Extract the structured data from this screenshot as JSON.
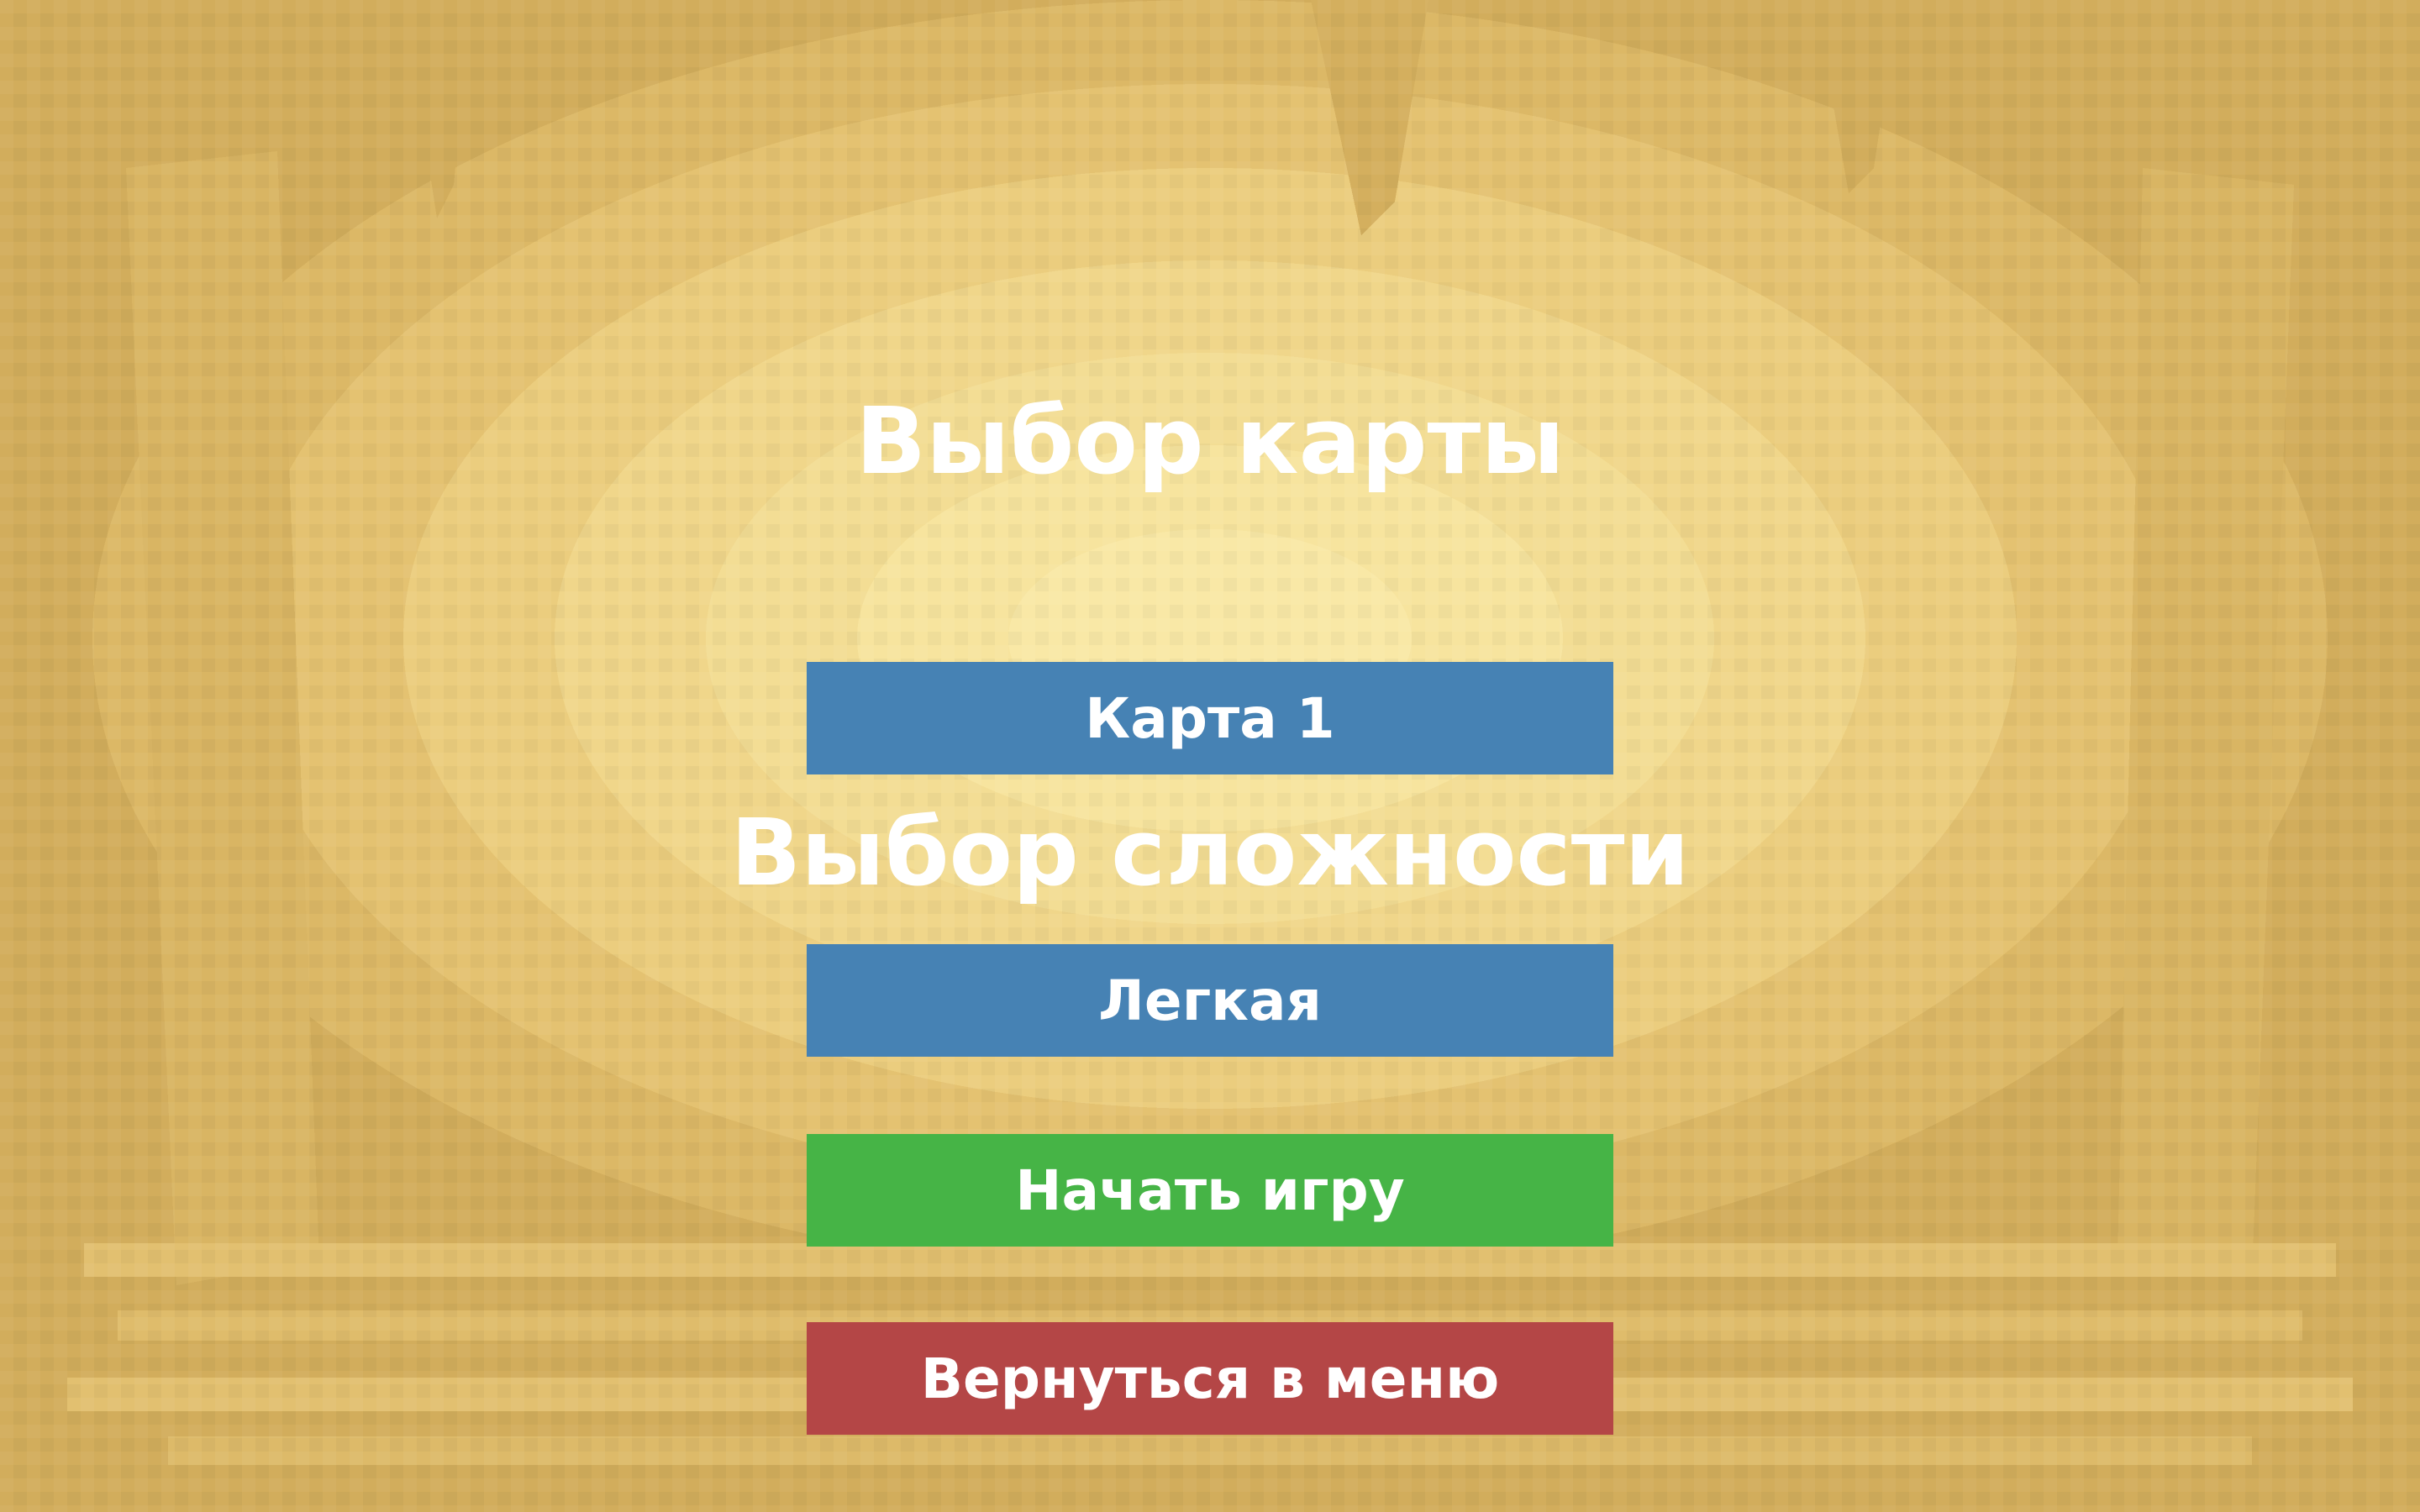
{
  "screen": {
    "map_title": "Выбор карты",
    "difficulty_title": "Выбор сложности"
  },
  "buttons": {
    "map": {
      "label": "Карта 1",
      "color": "#4682b4"
    },
    "difficulty": {
      "label": "Легкая",
      "color": "#4682b4"
    },
    "start": {
      "label": "Начать игру",
      "color": "#46b446"
    },
    "back": {
      "label": "Вернуться в меню",
      "color": "#b44646"
    }
  },
  "palette": {
    "sand_dark": "#d2ad5c",
    "sand_mid": "#dcb866",
    "sand_light": "#e8c97c",
    "sand_lighter": "#f0d88e",
    "sand_highlight": "#f7e6a0"
  }
}
